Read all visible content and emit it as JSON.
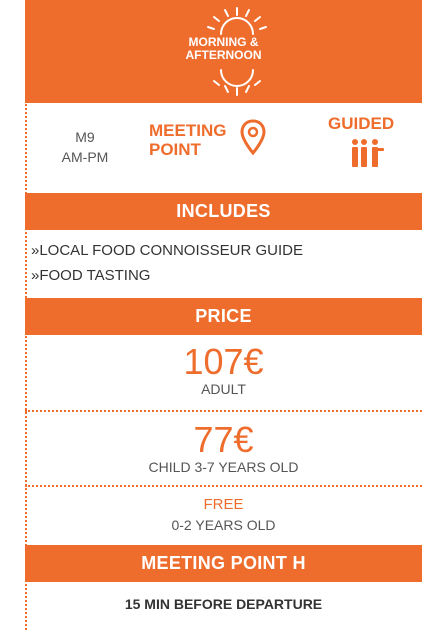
{
  "hero": {
    "line1": "MORNING &",
    "line2": "AFTERNOON",
    "icon": "sun-icon"
  },
  "info": {
    "time_line1": "M9",
    "time_line2": "AM-PM",
    "meeting_line1": "MEETING",
    "meeting_line2": "POINT",
    "guided": "GUIDED"
  },
  "includes": {
    "title": "INCLUDES",
    "items": [
      "»LOCAL FOOD CONNOISSEUR GUIDE",
      "»FOOD TASTING"
    ]
  },
  "price": {
    "title": "PRICE",
    "adult_value": "107",
    "adult_currency": "€",
    "adult_label": "ADULT",
    "child_value": "77",
    "child_currency": "€",
    "child_label": "CHILD 3-7 YEARS OLD",
    "infant_value": "FREE",
    "infant_label": "0-2 YEARS OLD"
  },
  "meeting_point": {
    "title": "MEETING POINT H",
    "note": "15 MIN BEFORE DEPARTURE"
  },
  "colors": {
    "accent": "#ee6d2d"
  }
}
